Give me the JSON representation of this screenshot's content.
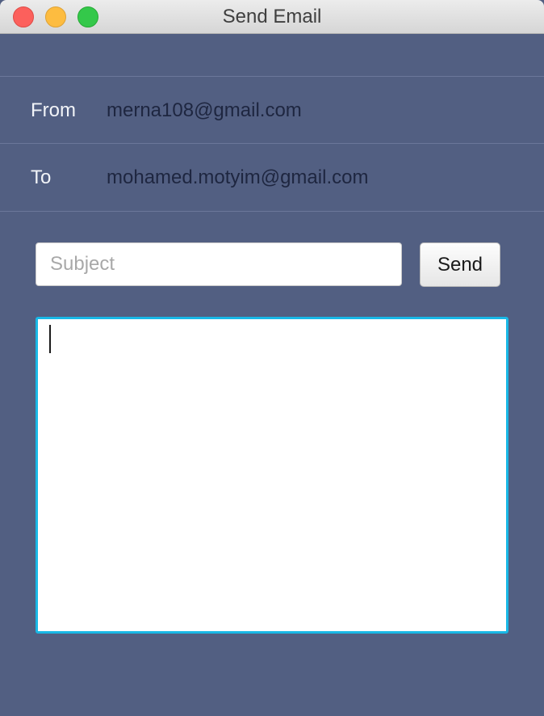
{
  "window": {
    "title": "Send Email"
  },
  "titlebar": {
    "buttons": [
      "close",
      "minimize",
      "zoom"
    ]
  },
  "header": {
    "from_label": "From",
    "from_value": "merna108@gmail.com",
    "to_label": "To",
    "to_value": "mohamed.motyim@gmail.com"
  },
  "compose": {
    "subject_placeholder": "Subject",
    "subject_value": "",
    "send_label": "Send",
    "body_value": ""
  },
  "colors": {
    "background": "#525f82",
    "focus_ring": "#19b8e6"
  }
}
